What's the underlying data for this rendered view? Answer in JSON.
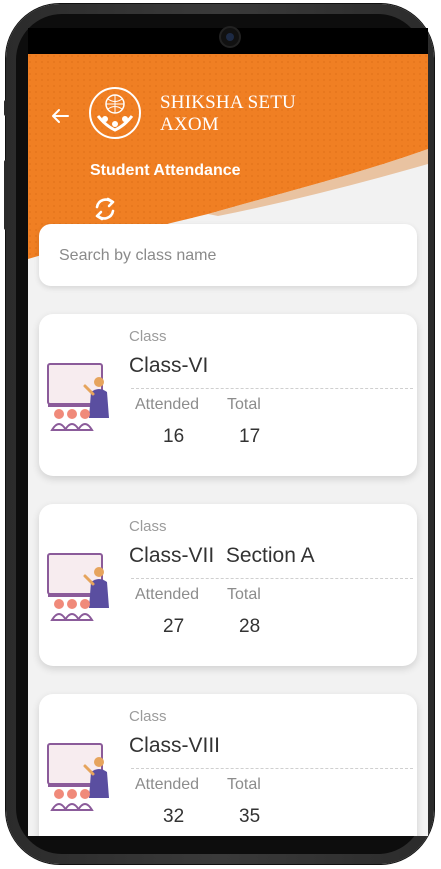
{
  "app": {
    "brand_line1": "SHIKSHA SETU",
    "brand_line2": "AXOM",
    "accent": "#f07f23"
  },
  "header": {
    "title": "Student Attendance"
  },
  "icons": {
    "back": "back-arrow-icon",
    "refresh": "refresh-icon",
    "logo": "shiksha-setu-logo",
    "class": "teacher-classroom-icon"
  },
  "search": {
    "placeholder": "Search by class name",
    "value": ""
  },
  "labels": {
    "class": "Class",
    "attended": "Attended",
    "total": "Total"
  },
  "classes": [
    {
      "name": "Class-VI",
      "attended": "16",
      "total": "17"
    },
    {
      "name": "Class-VII  Section A",
      "attended": "27",
      "total": "28"
    },
    {
      "name": "Class-VIII",
      "attended": "32",
      "total": "35"
    }
  ]
}
